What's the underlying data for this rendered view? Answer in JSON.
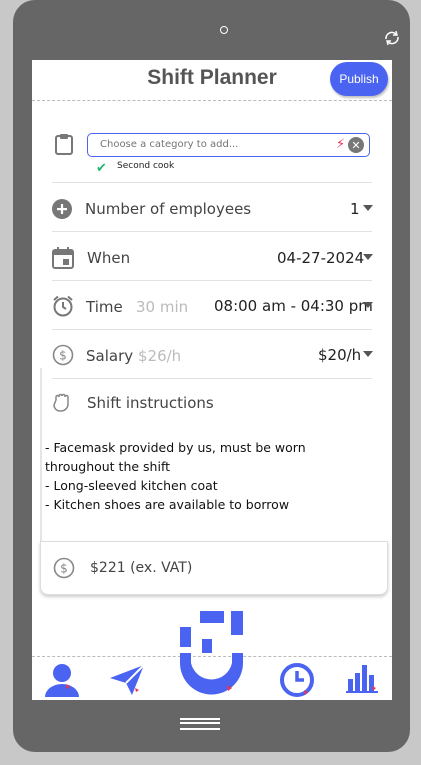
{
  "app": {
    "title": "Shift Planner",
    "publish_label": "Publish"
  },
  "category": {
    "placeholder": "Choose a category to add...",
    "selected_tag": "Second cook"
  },
  "employees": {
    "label": "Number of employees",
    "value": "1"
  },
  "when": {
    "label": "When",
    "value": "04-27-2024"
  },
  "time": {
    "label": "Time",
    "duration": "30 min",
    "value": "08:00 am - 04:30 pm"
  },
  "salary": {
    "label": "Salary",
    "hint": "$26/h",
    "value": "$20/h"
  },
  "instructions": {
    "label": "Shift instructions",
    "text": "- Facemask provided by us, must be worn throughout the shift\n- Long-sleeved kitchen coat\n- Kitchen shoes are available to borrow"
  },
  "total": {
    "value": "$221 (ex. VAT)"
  },
  "colors": {
    "accent": "#4a63f0",
    "alert": "#e83455",
    "check": "#22b573"
  },
  "icons": {
    "nav": [
      "profile-icon",
      "send-icon",
      "brand-logo-icon",
      "clock-icon",
      "chart-icon"
    ]
  }
}
